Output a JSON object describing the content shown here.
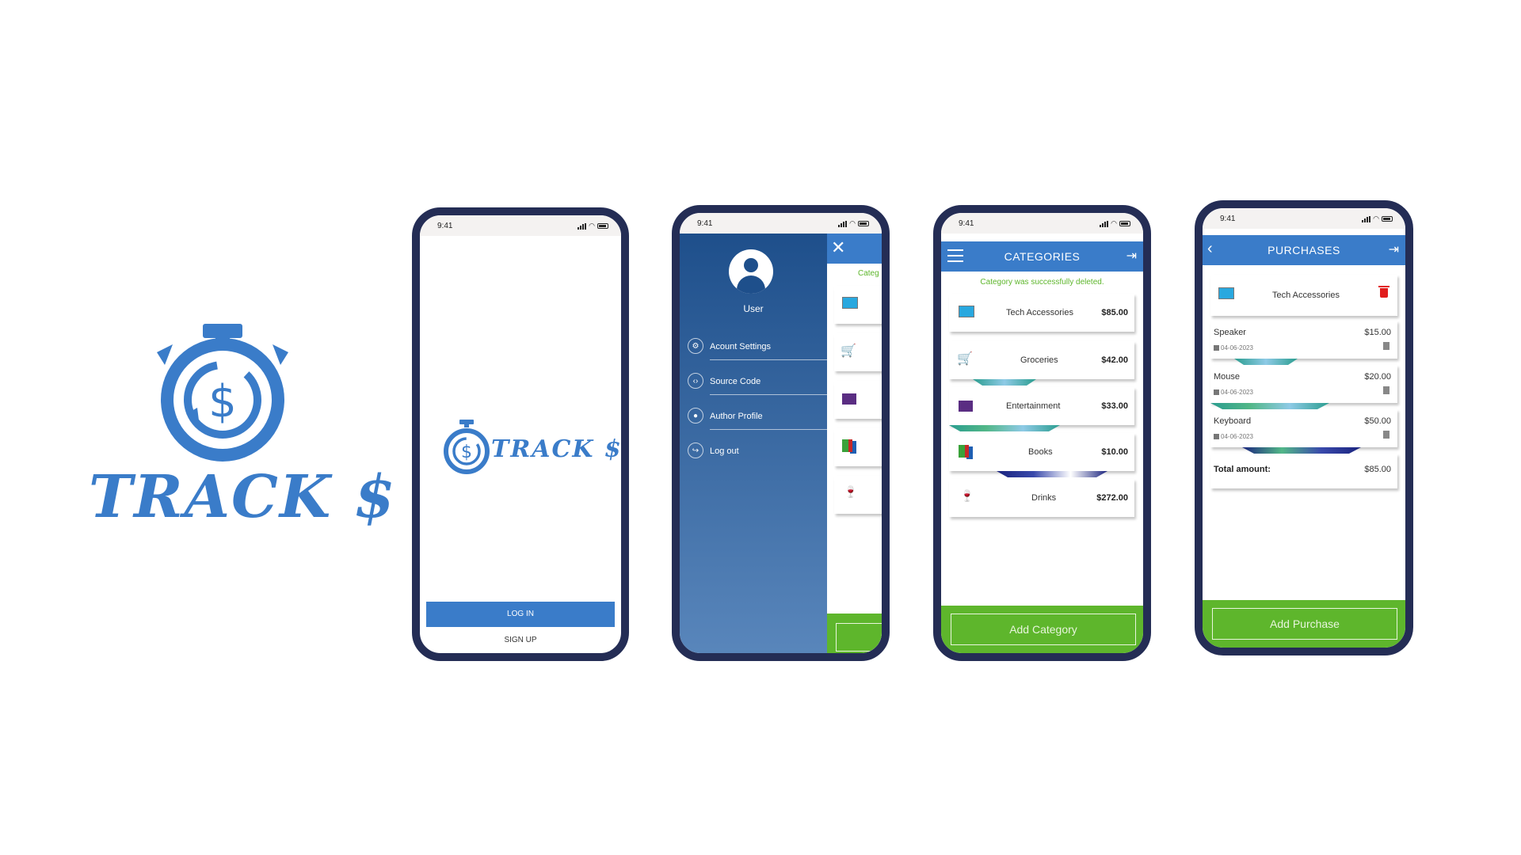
{
  "brand": {
    "name": "TRACK $",
    "accent": "#3a7cc9",
    "green": "#5eb62c",
    "frame": "#242d55"
  },
  "status": {
    "time": "9:41"
  },
  "login": {
    "brand_text": "TRACK $",
    "login_label": "LOG IN",
    "signup_label": "SIGN UP"
  },
  "drawer": {
    "user_label": "User",
    "items": [
      {
        "label": "Acount Settings",
        "icon": "gear-icon"
      },
      {
        "label": "Source Code",
        "icon": "code-icon"
      },
      {
        "label": "Author Profile",
        "icon": "github-icon"
      },
      {
        "label": "Log out",
        "icon": "logout-icon"
      }
    ],
    "peek_text": "Categ"
  },
  "categories": {
    "title": "CATEGORIES",
    "message": "Category was successfully deleted.",
    "items": [
      {
        "name": "Tech Accessories",
        "amount": "$85.00",
        "icon": "computer-icon"
      },
      {
        "name": "Groceries",
        "amount": "$42.00",
        "icon": "cart-icon"
      },
      {
        "name": "Entertainment",
        "amount": "$33.00",
        "icon": "clapperboard-icon"
      },
      {
        "name": "Books",
        "amount": "$10.00",
        "icon": "books-icon"
      },
      {
        "name": "Drinks",
        "amount": "$272.00",
        "icon": "wine-glass-icon"
      }
    ],
    "add_label": "Add Category"
  },
  "purchases": {
    "title": "PURCHASES",
    "category": "Tech Accessories",
    "items": [
      {
        "name": "Speaker",
        "amount": "$15.00",
        "date": "04-06-2023"
      },
      {
        "name": "Mouse",
        "amount": "$20.00",
        "date": "04-06-2023"
      },
      {
        "name": "Keyboard",
        "amount": "$50.00",
        "date": "04-06-2023"
      }
    ],
    "total_label": "Total amount:",
    "total_value": "$85.00",
    "add_label": "Add Purchase"
  }
}
